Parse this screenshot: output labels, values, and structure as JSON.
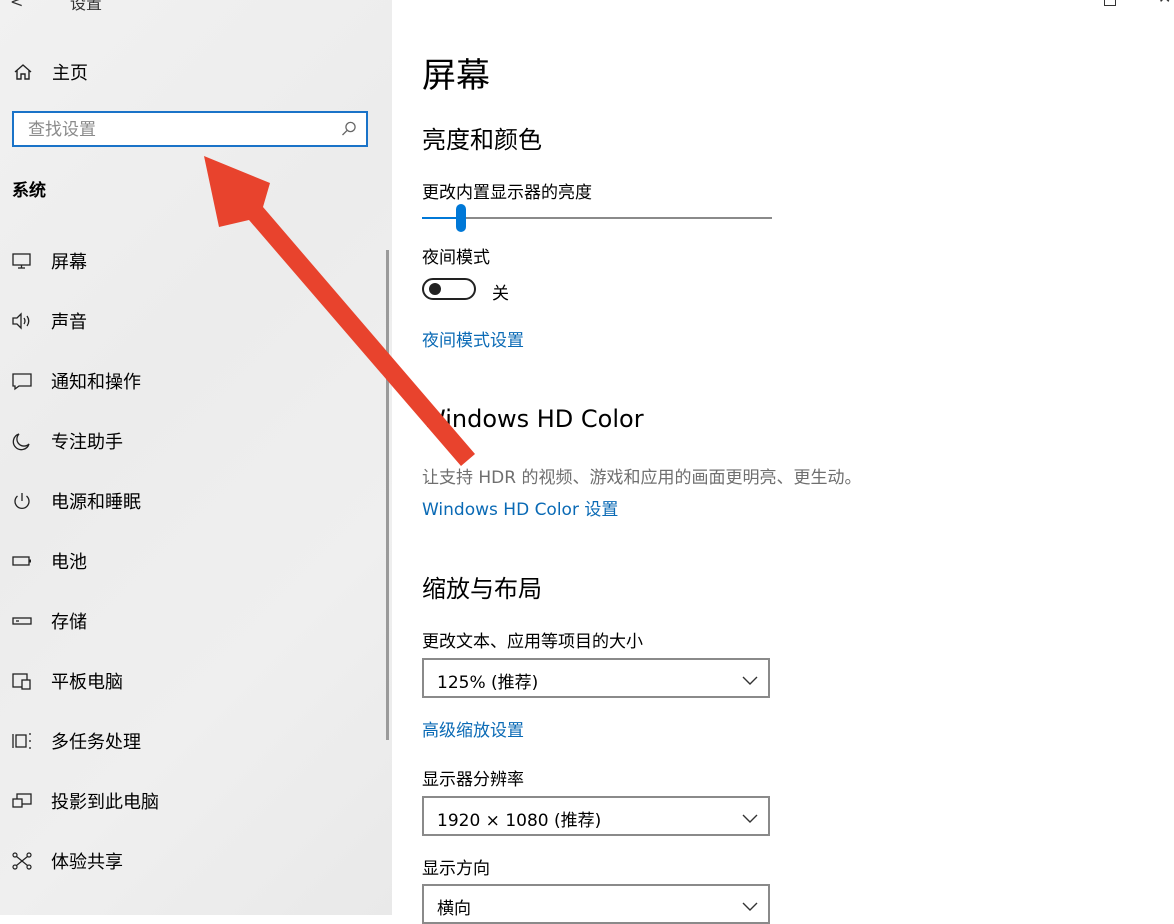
{
  "window": {
    "back_glyph": "<",
    "title": "设置",
    "close_glyph": "✕"
  },
  "sidebar": {
    "home_label": "主页",
    "search_placeholder": "查找设置",
    "section_title": "系统",
    "items": [
      {
        "label": "屏幕",
        "icon": "monitor-icon"
      },
      {
        "label": "声音",
        "icon": "speaker-icon"
      },
      {
        "label": "通知和操作",
        "icon": "notification-icon"
      },
      {
        "label": "专注助手",
        "icon": "moon-icon"
      },
      {
        "label": "电源和睡眠",
        "icon": "power-icon"
      },
      {
        "label": "电池",
        "icon": "battery-icon"
      },
      {
        "label": "存储",
        "icon": "storage-icon"
      },
      {
        "label": "平板电脑",
        "icon": "tablet-icon"
      },
      {
        "label": "多任务处理",
        "icon": "multitask-icon"
      },
      {
        "label": "投影到此电脑",
        "icon": "project-icon"
      },
      {
        "label": "体验共享",
        "icon": "share-icon"
      }
    ]
  },
  "main": {
    "page_title": "屏幕",
    "brightness_section": {
      "title": "亮度和颜色",
      "brightness_label": "更改内置显示器的亮度",
      "brightness_value": 0.11,
      "night_mode_label": "夜间模式",
      "night_mode_state": "关",
      "night_mode_on": false,
      "night_mode_link": "夜间模式设置"
    },
    "hdr_section": {
      "title": "Windows HD Color",
      "description": "让支持 HDR 的视频、游戏和应用的画面更明亮、更生动。",
      "link": "Windows HD Color 设置"
    },
    "layout_section": {
      "title": "缩放与布局",
      "scale_label": "更改文本、应用等项目的大小",
      "scale_value": "125% (推荐)",
      "advanced_link": "高级缩放设置",
      "resolution_label": "显示器分辨率",
      "resolution_value": "1920 × 1080 (推荐)",
      "orientation_label": "显示方向",
      "orientation_value": "横向"
    }
  },
  "colors": {
    "accent": "#0078d7",
    "link": "#0a6ab5",
    "annotation_arrow": "#e8432d"
  }
}
